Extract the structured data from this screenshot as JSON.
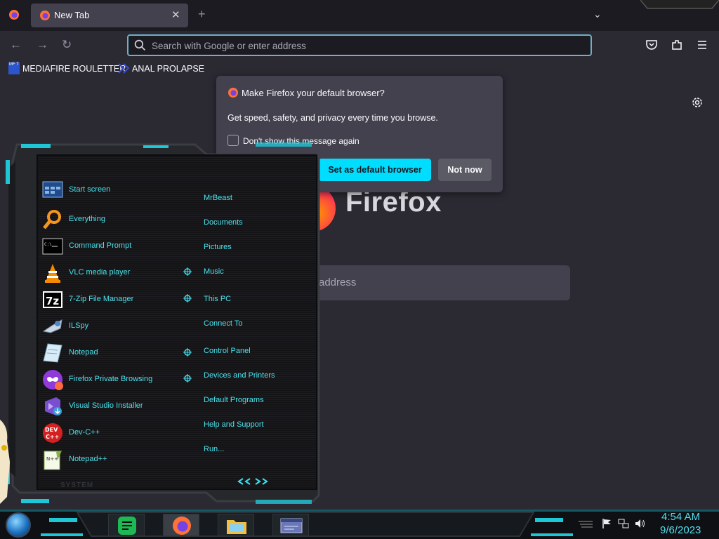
{
  "browser": {
    "tab": {
      "title": "New Tab"
    },
    "urlbar": {
      "placeholder": "Search with Google or enter address"
    },
    "bookmarks": [
      {
        "label": "MEDIAFIRE ROULETTER",
        "icon_text": "MF T"
      },
      {
        "label": "ANAL PROLAPSE"
      }
    ],
    "newtab": {
      "brand_word": "Firefox",
      "search_placeholder_visible": "address"
    },
    "default_prompt": {
      "title": "Make Firefox your default browser?",
      "body": "Get speed, safety, and privacy every time you browse.",
      "checkbox_label": "Don't show this message again",
      "primary_button": "Set as default browser",
      "secondary_button": "Not now"
    }
  },
  "start_menu": {
    "programs": [
      {
        "label": "Start screen",
        "icon": "start-screen-icon"
      },
      {
        "label": "Everything",
        "icon": "everything-search-icon"
      },
      {
        "label": "Command Prompt",
        "icon": "command-prompt-icon"
      },
      {
        "label": "VLC media player",
        "icon": "vlc-cone-icon"
      },
      {
        "label": "7-Zip File Manager",
        "icon": "7zip-icon"
      },
      {
        "label": "ILSpy",
        "icon": "ilspy-icon"
      },
      {
        "label": "Notepad",
        "icon": "notepad-icon"
      },
      {
        "label": "Firefox Private Browsing",
        "icon": "firefox-private-icon"
      },
      {
        "label": "Visual Studio Installer",
        "icon": "visual-studio-installer-icon"
      },
      {
        "label": "Dev-C++",
        "icon": "devcpp-icon"
      },
      {
        "label": "Notepad++",
        "icon": "notepad-plus-plus-icon"
      }
    ],
    "places": [
      {
        "label": "MrBeast"
      },
      {
        "label": "Documents"
      },
      {
        "label": "Pictures"
      },
      {
        "label": "Music"
      },
      {
        "label": "This PC"
      },
      {
        "label": "Connect To"
      },
      {
        "label": "Control Panel"
      },
      {
        "label": "Devices and Printers"
      },
      {
        "label": "Default Programs"
      },
      {
        "label": "Help and Support"
      },
      {
        "label": "Run..."
      }
    ],
    "footer_label": "SYSTEM",
    "accent_color": "#3fe0ee"
  },
  "taskbar": {
    "apps": [
      {
        "name": "notes-app"
      },
      {
        "name": "firefox"
      },
      {
        "name": "file-explorer"
      },
      {
        "name": "window-app"
      }
    ],
    "clock": {
      "time": "4:54 AM",
      "date": "9/6/2023"
    }
  },
  "colors": {
    "accent_cyan": "#00ddff",
    "toolbar": "#2b2a33",
    "tabstrip": "#1c1b22"
  }
}
